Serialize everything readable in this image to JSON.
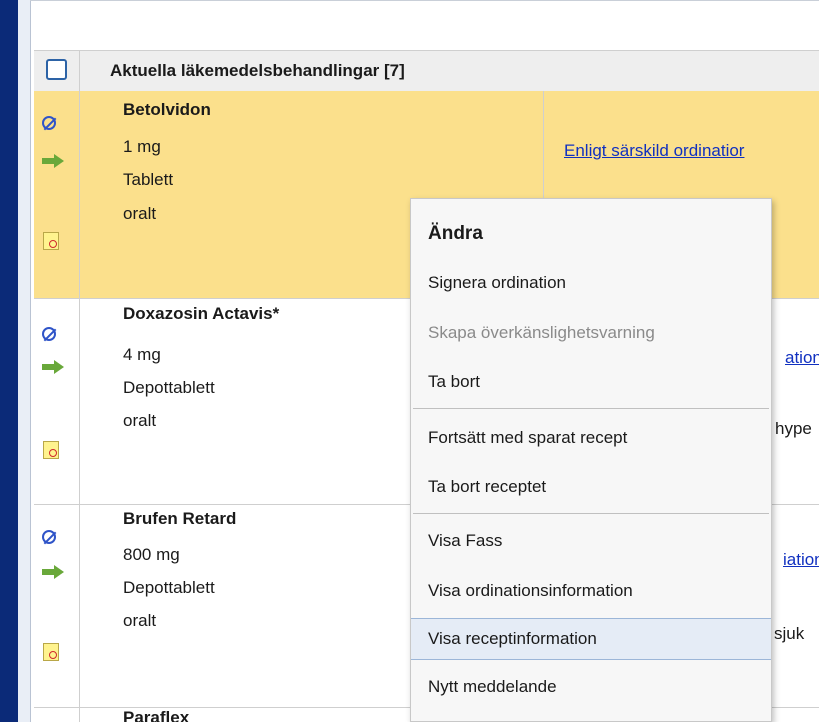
{
  "table": {
    "header_title": "Aktuella läkemedelsbehandlingar [7]",
    "rows": [
      {
        "name": "Betolvidon",
        "dose": "1 mg",
        "form": "Tablett",
        "route": "oralt",
        "link": "Enligt särskild ordinatior",
        "extra": ""
      },
      {
        "name": "Doxazosin Actavis*",
        "dose": "4 mg",
        "form": "Depottablett",
        "route": "oralt",
        "link": "ation",
        "extra": "hype"
      },
      {
        "name": "Brufen Retard",
        "dose": "800 mg",
        "form": "Depottablett",
        "route": "oralt",
        "link": "iation",
        "extra": "sjuk"
      },
      {
        "name": "Paraflex",
        "dose": "",
        "form": "",
        "route": "",
        "link": "",
        "extra": ""
      }
    ]
  },
  "context_menu": {
    "items": [
      {
        "label": "Ändra",
        "style": "title"
      },
      {
        "label": "Signera ordination",
        "style": "normal"
      },
      {
        "label": "Skapa överkänslighetsvarning",
        "style": "disabled"
      },
      {
        "label": "Ta bort",
        "style": "normal"
      },
      {
        "label": "Fortsätt med sparat recept",
        "style": "normal"
      },
      {
        "label": "Ta bort receptet",
        "style": "normal"
      },
      {
        "label": "Visa Fass",
        "style": "normal"
      },
      {
        "label": "Visa ordinationsinformation",
        "style": "normal"
      },
      {
        "label": "Visa receptinformation",
        "style": "hover"
      },
      {
        "label": "Nytt meddelande",
        "style": "normal"
      }
    ]
  },
  "colors": {
    "selected_row": "#fbe08c",
    "link": "#1030c0",
    "sidebar": "#0b2a78",
    "arrow_green": "#69a83a",
    "prohibit_blue": "#2f54c8"
  }
}
